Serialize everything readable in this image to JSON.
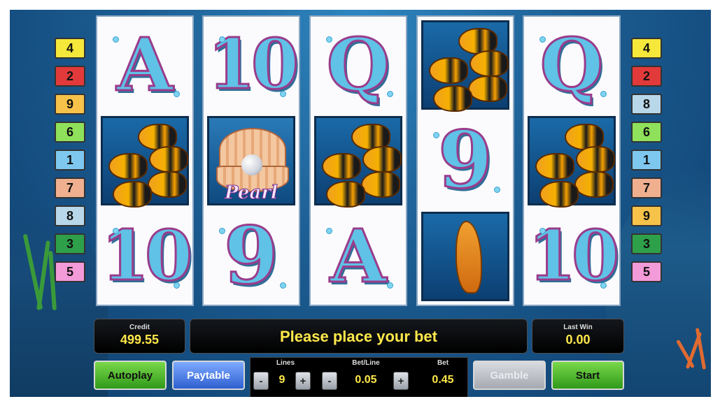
{
  "reels": [
    {
      "cells": [
        {
          "symbol": "A",
          "type": "letter"
        },
        {
          "symbol": "fish-icon",
          "type": "fish"
        },
        {
          "symbol": "10",
          "type": "num"
        }
      ]
    },
    {
      "cells": [
        {
          "symbol": "10",
          "type": "num"
        },
        {
          "symbol": "Pearl",
          "type": "pearl"
        },
        {
          "symbol": "9",
          "type": "nine"
        }
      ]
    },
    {
      "cells": [
        {
          "symbol": "Q",
          "type": "letter"
        },
        {
          "symbol": "fish-icon",
          "type": "fish"
        },
        {
          "symbol": "A",
          "type": "letter"
        }
      ]
    },
    {
      "cells": [
        {
          "symbol": "fish-icon",
          "type": "fish"
        },
        {
          "symbol": "9",
          "type": "nine"
        },
        {
          "symbol": "seahorse-icon",
          "type": "seahorse"
        }
      ]
    },
    {
      "cells": [
        {
          "symbol": "Q",
          "type": "letter"
        },
        {
          "symbol": "fish-icon",
          "type": "fish"
        },
        {
          "symbol": "10",
          "type": "num"
        }
      ]
    }
  ],
  "left_lines": [
    {
      "label": "4",
      "color": "#f5e83a"
    },
    {
      "label": "2",
      "color": "#e23a3a"
    },
    {
      "label": "9",
      "color": "#f6c24a"
    },
    {
      "label": "6",
      "color": "#8fe05a"
    },
    {
      "label": "1",
      "color": "#7ec8f0"
    },
    {
      "label": "7",
      "color": "#f0b090"
    },
    {
      "label": "8",
      "color": "#b8d8ea"
    },
    {
      "label": "3",
      "color": "#2ea04a"
    },
    {
      "label": "5",
      "color": "#f39ad8"
    }
  ],
  "right_lines": [
    {
      "label": "4",
      "color": "#f5e83a"
    },
    {
      "label": "2",
      "color": "#e23a3a"
    },
    {
      "label": "8",
      "color": "#b8d8ea"
    },
    {
      "label": "6",
      "color": "#8fe05a"
    },
    {
      "label": "1",
      "color": "#7ec8f0"
    },
    {
      "label": "7",
      "color": "#f0b090"
    },
    {
      "label": "9",
      "color": "#f6c24a"
    },
    {
      "label": "3",
      "color": "#2ea04a"
    },
    {
      "label": "5",
      "color": "#f39ad8"
    }
  ],
  "credit": {
    "label": "Credit",
    "value": "499.55"
  },
  "message": "Please place your bet",
  "last_win": {
    "label": "Last Win",
    "value": "0.00"
  },
  "buttons": {
    "autoplay": "Autoplay",
    "paytable": "Paytable",
    "gamble": "Gamble",
    "start": "Start"
  },
  "controls": {
    "lines_label": "Lines",
    "lines_value": "9",
    "bet_line_label": "Bet/Line",
    "bet_line_value": "0.05",
    "bet_label": "Bet",
    "bet_value": "0.45",
    "minus": "-",
    "plus": "+"
  }
}
